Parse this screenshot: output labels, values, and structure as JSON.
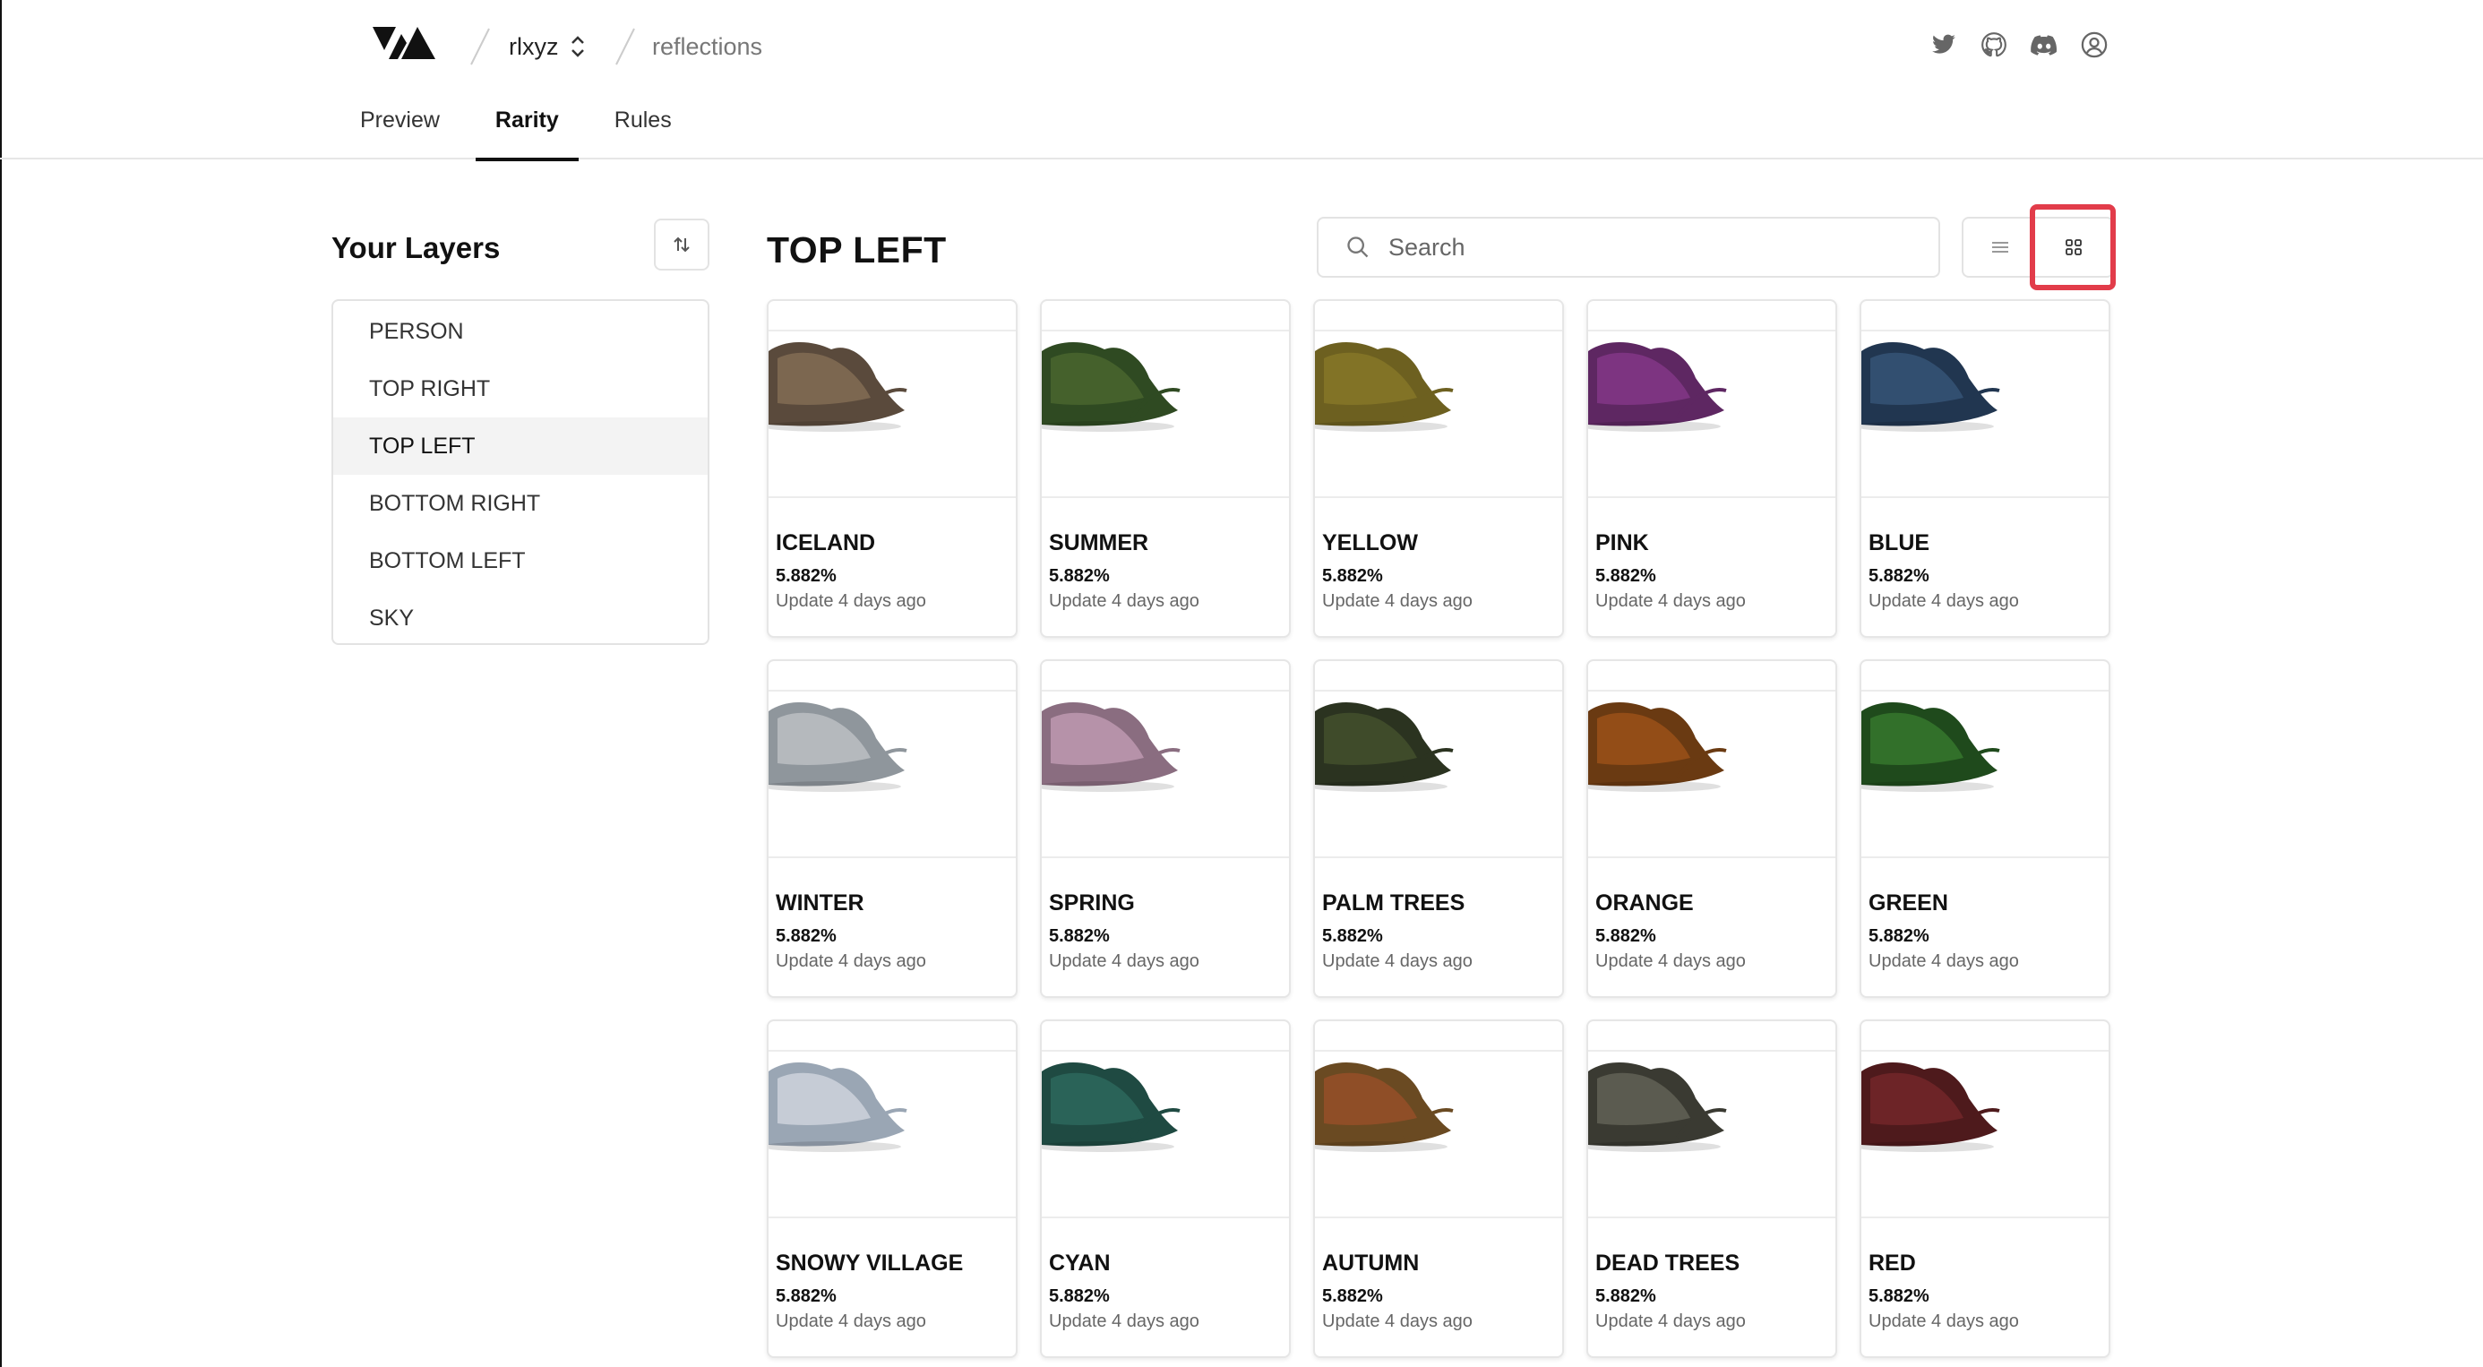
{
  "header": {
    "team": "rlxyz",
    "project": "reflections",
    "icons": [
      "twitter-icon",
      "github-icon",
      "discord-icon",
      "user-circle-icon"
    ]
  },
  "tabs": [
    {
      "label": "Preview",
      "active": false
    },
    {
      "label": "Rarity",
      "active": true
    },
    {
      "label": "Rules",
      "active": false
    }
  ],
  "sidebar": {
    "title": "Your Layers",
    "layers": [
      "PERSON",
      "TOP RIGHT",
      "TOP LEFT",
      "BOTTOM RIGHT",
      "BOTTOM LEFT",
      "SKY"
    ],
    "active_layer": "TOP LEFT"
  },
  "main": {
    "title": "TOP LEFT",
    "search_placeholder": "Search",
    "view_mode": "grid",
    "highlight_color": "#e23c4a",
    "traits": [
      {
        "name": "ICELAND",
        "rarity": "5.882%",
        "updated": "Update 4 days ago",
        "color": "#5a4a3c",
        "accent": "#8a7458"
      },
      {
        "name": "SUMMER",
        "rarity": "5.882%",
        "updated": "Update 4 days ago",
        "color": "#2f4a22",
        "accent": "#4f6b30"
      },
      {
        "name": "YELLOW",
        "rarity": "5.882%",
        "updated": "Update 4 days ago",
        "color": "#6d6020",
        "accent": "#8c7c2a"
      },
      {
        "name": "PINK",
        "rarity": "5.882%",
        "updated": "Update 4 days ago",
        "color": "#5e2762",
        "accent": "#8a3a8e"
      },
      {
        "name": "BLUE",
        "rarity": "5.882%",
        "updated": "Update 4 days ago",
        "color": "#213650",
        "accent": "#3a5a7e"
      },
      {
        "name": "WINTER",
        "rarity": "5.882%",
        "updated": "Update 4 days ago",
        "color": "#8f969c",
        "accent": "#c4c8cc"
      },
      {
        "name": "SPRING",
        "rarity": "5.882%",
        "updated": "Update 4 days ago",
        "color": "#8a6d80",
        "accent": "#c9a3bb"
      },
      {
        "name": "PALM TREES",
        "rarity": "5.882%",
        "updated": "Update 4 days ago",
        "color": "#2b3320",
        "accent": "#48552f"
      },
      {
        "name": "ORANGE",
        "rarity": "5.882%",
        "updated": "Update 4 days ago",
        "color": "#6a3a12",
        "accent": "#a5561a"
      },
      {
        "name": "GREEN",
        "rarity": "5.882%",
        "updated": "Update 4 days ago",
        "color": "#1f4a1c",
        "accent": "#3b8030"
      },
      {
        "name": "SNOWY VILLAGE",
        "rarity": "5.882%",
        "updated": "Update 4 days ago",
        "color": "#9aa6b4",
        "accent": "#d8dde4"
      },
      {
        "name": "CYAN",
        "rarity": "5.882%",
        "updated": "Update 4 days ago",
        "color": "#1f4a42",
        "accent": "#2f6e62"
      },
      {
        "name": "AUTUMN",
        "rarity": "5.882%",
        "updated": "Update 4 days ago",
        "color": "#6a4a22",
        "accent": "#a0502a"
      },
      {
        "name": "DEAD TREES",
        "rarity": "5.882%",
        "updated": "Update 4 days ago",
        "color": "#3a3a32",
        "accent": "#6a6a5c"
      },
      {
        "name": "RED",
        "rarity": "5.882%",
        "updated": "Update 4 days ago",
        "color": "#4e1a1c",
        "accent": "#7a2a2c"
      }
    ]
  }
}
